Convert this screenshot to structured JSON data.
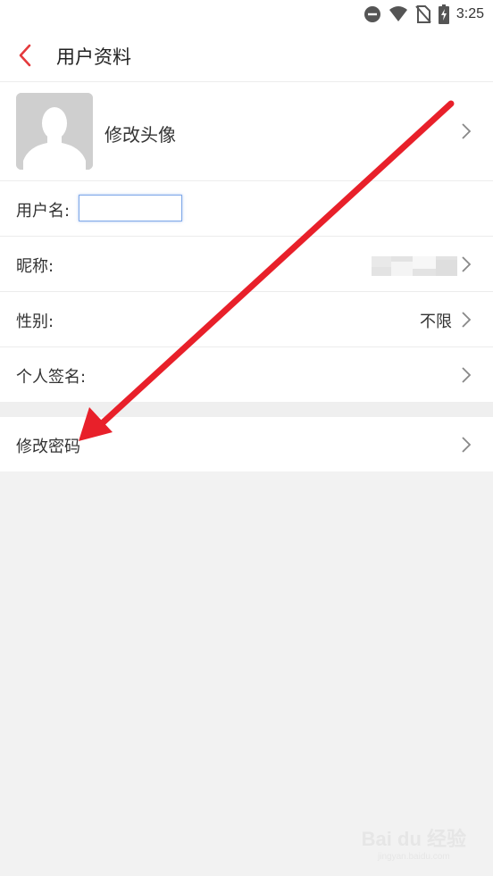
{
  "status_bar": {
    "time": "3:25",
    "icons": [
      "dnd-icon",
      "wifi-icon",
      "no-sim-icon",
      "battery-charging-icon"
    ]
  },
  "header": {
    "back_icon": "chevron-left-icon",
    "title": "用户资料"
  },
  "profile": {
    "avatar_label": "修改头像",
    "username_label": "用户名:",
    "username_value": "",
    "nickname_label": "昵称:",
    "gender_label": "性别:",
    "gender_value": "不限",
    "signature_label": "个人签名:"
  },
  "security": {
    "change_password_label": "修改密码"
  },
  "watermark": {
    "brand": "Bai du 经验",
    "url": "jingyan.baidu.com"
  },
  "colors": {
    "accent_red": "#e43a3d",
    "annotation_arrow": "#e8202a",
    "background": "#f2f2f2",
    "row_background": "#ffffff"
  }
}
